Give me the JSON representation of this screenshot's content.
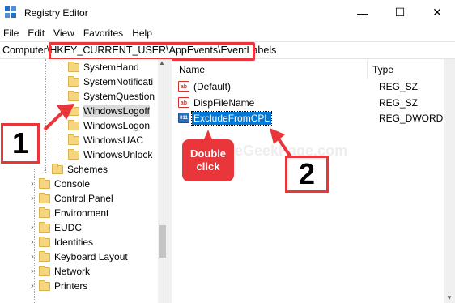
{
  "window": {
    "title": "Registry Editor",
    "minimize": "—",
    "maximize": "☐",
    "close": "✕"
  },
  "menu": [
    "File",
    "Edit",
    "View",
    "Favorites",
    "Help"
  ],
  "address": {
    "prefix": "Computer\\",
    "path": "HKEY_CURRENT_USER\\AppEvents\\EventLabels"
  },
  "tree": {
    "items": [
      {
        "label": "SystemHand"
      },
      {
        "label": "SystemNotificati"
      },
      {
        "label": "SystemQuestion"
      },
      {
        "label": "WindowsLogoff",
        "selected": true
      },
      {
        "label": "WindowsLogon"
      },
      {
        "label": "WindowsUAC"
      },
      {
        "label": "WindowsUnlock"
      },
      {
        "label": "Schemes"
      },
      {
        "label": "Console"
      },
      {
        "label": "Control Panel"
      },
      {
        "label": "Environment"
      },
      {
        "label": "EUDC"
      },
      {
        "label": "Identities"
      },
      {
        "label": "Keyboard Layout"
      },
      {
        "label": "Network"
      },
      {
        "label": "Printers"
      }
    ]
  },
  "list": {
    "headers": {
      "name": "Name",
      "type": "Type"
    },
    "rows": [
      {
        "name": "(Default)",
        "type": "REG_SZ",
        "icon": "string-value-icon"
      },
      {
        "name": "DispFileName",
        "type": "REG_SZ",
        "icon": "string-value-icon"
      },
      {
        "name": "ExcludeFromCPL",
        "type": "REG_DWORD",
        "icon": "binary-value-icon",
        "selected": true
      }
    ]
  },
  "icons": {
    "string_glyph": "ab",
    "binary_glyph": "011"
  },
  "annotations": {
    "step1": "1",
    "step2": "2",
    "callout_line1": "Double",
    "callout_line2": "click",
    "color": "#e8363a"
  },
  "watermark": "TheGeekPage.com"
}
